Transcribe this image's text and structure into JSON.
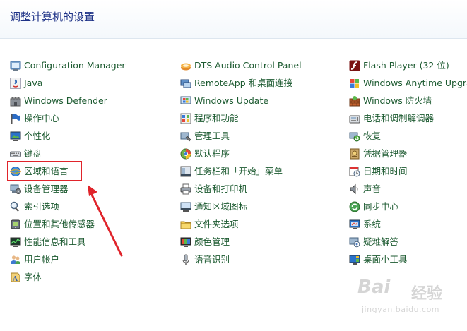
{
  "header": {
    "title": "调整计算机的设置"
  },
  "columns": [
    {
      "items": [
        {
          "label": "Configuration Manager",
          "icon": "configuration-manager-icon"
        },
        {
          "label": "Java",
          "icon": "java-icon"
        },
        {
          "label": "Windows Defender",
          "icon": "defender-castle-icon"
        },
        {
          "label": "操作中心",
          "icon": "action-center-flag-icon"
        },
        {
          "label": "个性化",
          "icon": "personalization-icon"
        },
        {
          "label": "键盘",
          "icon": "keyboard-icon"
        },
        {
          "label": "区域和语言",
          "icon": "globe-icon"
        },
        {
          "label": "设备管理器",
          "icon": "device-manager-icon"
        },
        {
          "label": "索引选项",
          "icon": "indexing-options-icon"
        },
        {
          "label": "位置和其他传感器",
          "icon": "location-sensor-icon"
        },
        {
          "label": "性能信息和工具",
          "icon": "performance-icon"
        },
        {
          "label": "用户帐户",
          "icon": "user-accounts-icon"
        },
        {
          "label": "字体",
          "icon": "fonts-icon"
        }
      ]
    },
    {
      "items": [
        {
          "label": "DTS Audio Control Panel",
          "icon": "dts-audio-icon"
        },
        {
          "label": "RemoteApp 和桌面连接",
          "icon": "remoteapp-icon"
        },
        {
          "label": "Windows Update",
          "icon": "windows-update-icon"
        },
        {
          "label": "程序和功能",
          "icon": "programs-features-icon"
        },
        {
          "label": "管理工具",
          "icon": "admin-tools-icon"
        },
        {
          "label": "默认程序",
          "icon": "default-programs-icon"
        },
        {
          "label": "任务栏和「开始」菜单",
          "icon": "taskbar-icon"
        },
        {
          "label": "设备和打印机",
          "icon": "printer-icon"
        },
        {
          "label": "通知区域图标",
          "icon": "notification-area-icon"
        },
        {
          "label": "文件夹选项",
          "icon": "folder-options-icon"
        },
        {
          "label": "颜色管理",
          "icon": "color-management-icon"
        },
        {
          "label": "语音识别",
          "icon": "microphone-icon"
        }
      ]
    },
    {
      "items": [
        {
          "label": "Flash Player (32 位)",
          "icon": "flash-player-icon"
        },
        {
          "label": "Windows Anytime Upgrade",
          "icon": "anytime-upgrade-icon"
        },
        {
          "label": "Windows 防火墙",
          "icon": "firewall-icon"
        },
        {
          "label": "电话和调制解调器",
          "icon": "phone-modem-icon"
        },
        {
          "label": "恢复",
          "icon": "recovery-icon"
        },
        {
          "label": "凭据管理器",
          "icon": "credential-manager-icon"
        },
        {
          "label": "日期和时间",
          "icon": "date-time-icon"
        },
        {
          "label": "声音",
          "icon": "speaker-icon"
        },
        {
          "label": "同步中心",
          "icon": "sync-center-icon"
        },
        {
          "label": "系统",
          "icon": "system-icon"
        },
        {
          "label": "疑难解答",
          "icon": "troubleshooting-icon"
        },
        {
          "label": "桌面小工具",
          "icon": "desktop-gadgets-icon"
        }
      ]
    }
  ],
  "watermark": {
    "brand": "Bai",
    "brand_cn": "经验",
    "url": "jingyan.baidu.com"
  }
}
